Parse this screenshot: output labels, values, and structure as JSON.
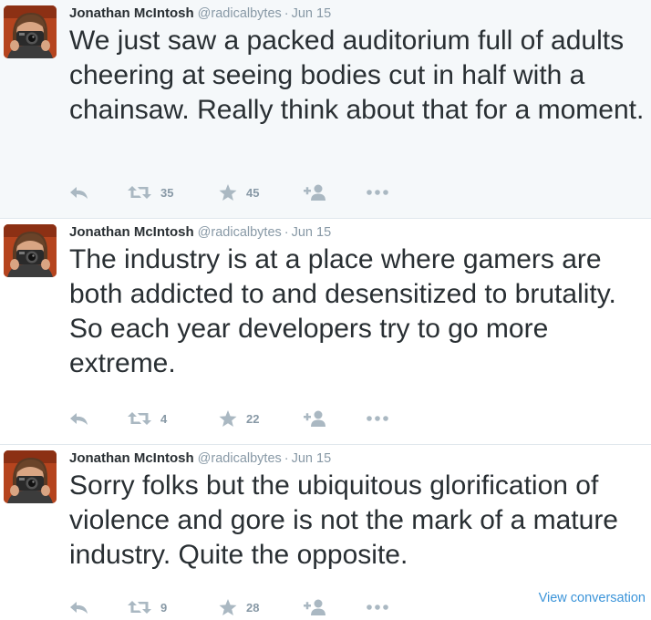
{
  "tweets": [
    {
      "fullname": "Jonathan McIntosh",
      "username": "@radicalbytes",
      "separator": "·",
      "time": "Jun 15",
      "text": "We just saw a packed auditorium full of adults cheering at seeing bodies cut in half with a chainsaw. Really think about that for a moment.",
      "retweets": "35",
      "favorites": "45"
    },
    {
      "fullname": "Jonathan McIntosh",
      "username": "@radicalbytes",
      "separator": "·",
      "time": "Jun 15",
      "text": "The industry is at a place where gamers are both addicted to and desensitized to brutality. So each year developers try to go more extreme.",
      "retweets": "4",
      "favorites": "22"
    },
    {
      "fullname": "Jonathan McIntosh",
      "username": "@radicalbytes",
      "separator": "·",
      "time": "Jun 15",
      "text": "Sorry folks but the ubiquitous glorification of violence and gore is not the mark of a mature industry. Quite the opposite.",
      "retweets": "9",
      "favorites": "28",
      "view_conversation": "View conversation"
    }
  ],
  "icons": {
    "reply": "reply-icon",
    "retweet": "retweet-icon",
    "favorite": "star-icon",
    "follow": "follow-icon",
    "more": "more-icon"
  },
  "colors": {
    "text": "#292f33",
    "muted": "#8899a6",
    "icon": "#aab8c2",
    "link": "#3b94d9",
    "highlight_bg": "#f5f8fa",
    "avatar_bg": "#b5441e"
  }
}
